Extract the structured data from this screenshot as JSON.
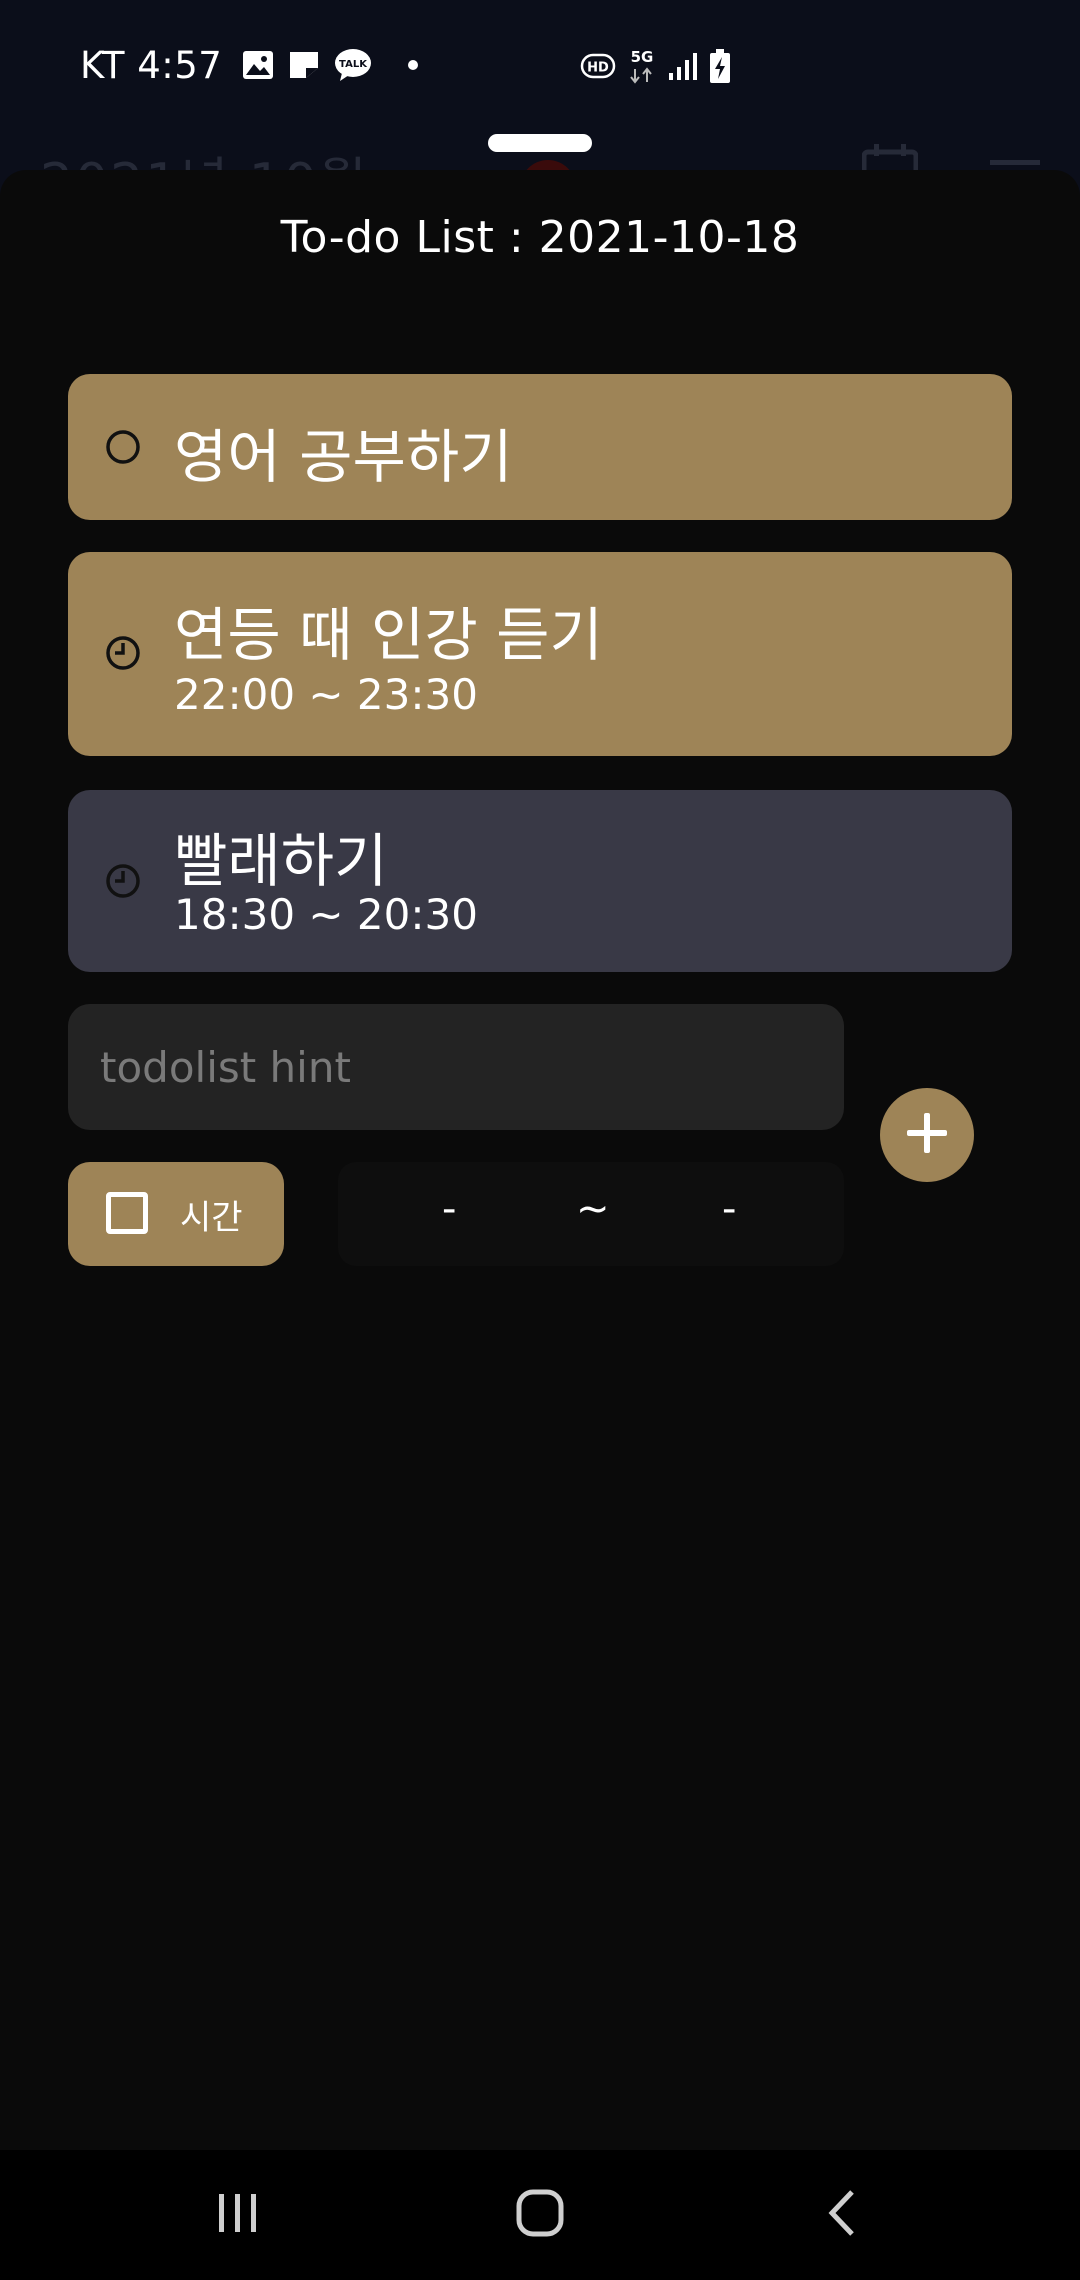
{
  "status_bar": {
    "carrier_time": "KT 4:57",
    "icons_left": [
      "gallery-icon",
      "note-icon",
      "kakaotalk-icon",
      "dot-icon"
    ],
    "talk_label": "TALK",
    "icons_right": [
      "hd-icon",
      "5g-icon",
      "signal-icon",
      "battery-charging-icon"
    ],
    "hd_label": "HD",
    "network_label": "5G"
  },
  "background": {
    "header_text": "2021년 10월"
  },
  "sheet": {
    "title": "To-do List : 2021-10-18",
    "todos": [
      {
        "title": "영어 공부하기",
        "time": "",
        "icon": "circle-icon",
        "color": "#9e8457"
      },
      {
        "title": "연등 때 인강 듣기",
        "time": "22:00 ~ 23:30",
        "icon": "clock-icon",
        "color": "#9e8457"
      },
      {
        "title": "빨래하기",
        "time": "18:30 ~ 20:30",
        "icon": "clock-icon",
        "color": "#393946"
      }
    ],
    "input": {
      "value": "",
      "placeholder": "todolist hint"
    },
    "add_button_icon": "plus-icon",
    "time_toggle": {
      "checked": false,
      "label": "시간"
    },
    "time_range": {
      "start": "-",
      "separator": "~",
      "end": "-"
    }
  },
  "nav_bar": {
    "buttons": [
      "recents-icon",
      "home-icon",
      "back-icon"
    ]
  },
  "colors": {
    "accent": "#9e8457",
    "card_alt": "#393946",
    "sheet_bg": "#0a0a0a",
    "input_bg": "#232323"
  }
}
